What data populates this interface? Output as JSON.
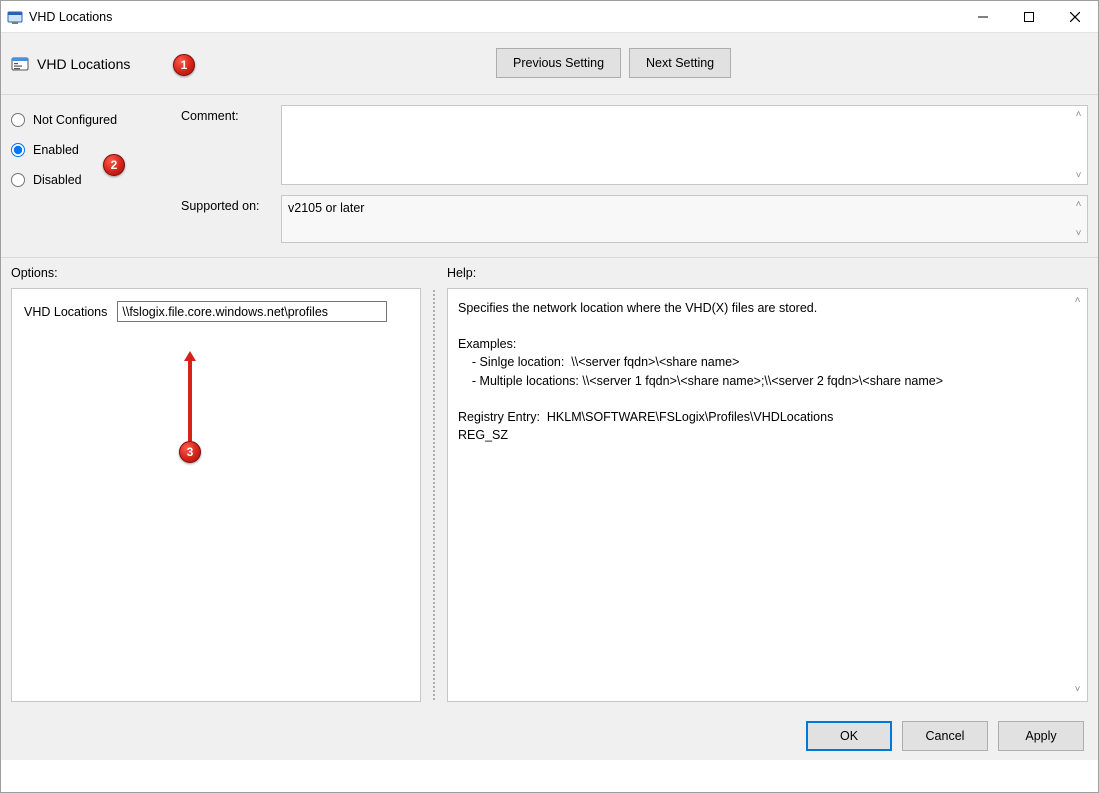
{
  "window": {
    "title": "VHD Locations"
  },
  "header": {
    "policy_name": "VHD Locations",
    "prev_label": "Previous Setting",
    "next_label": "Next Setting"
  },
  "state": {
    "not_configured_label": "Not Configured",
    "enabled_label": "Enabled",
    "disabled_label": "Disabled",
    "selected": "enabled"
  },
  "fields": {
    "comment_label": "Comment:",
    "comment_value": "",
    "supported_label": "Supported on:",
    "supported_value": "v2105 or later"
  },
  "options": {
    "pane_title": "Options:",
    "vhd_locations_label": "VHD Locations",
    "vhd_locations_value": "\\\\fslogix.file.core.windows.net\\profiles"
  },
  "help": {
    "pane_title": "Help:",
    "text": "Specifies the network location where the VHD(X) files are stored.\n\nExamples:\n    - Sinlge location:  \\\\<server fqdn>\\<share name>\n    - Multiple locations: \\\\<server 1 fqdn>\\<share name>;\\\\<server 2 fqdn>\\<share name>\n\nRegistry Entry:  HKLM\\SOFTWARE\\FSLogix\\Profiles\\VHDLocations\nREG_SZ"
  },
  "footer": {
    "ok": "OK",
    "cancel": "Cancel",
    "apply": "Apply"
  },
  "callouts": {
    "c1": "1",
    "c2": "2",
    "c3": "3"
  }
}
